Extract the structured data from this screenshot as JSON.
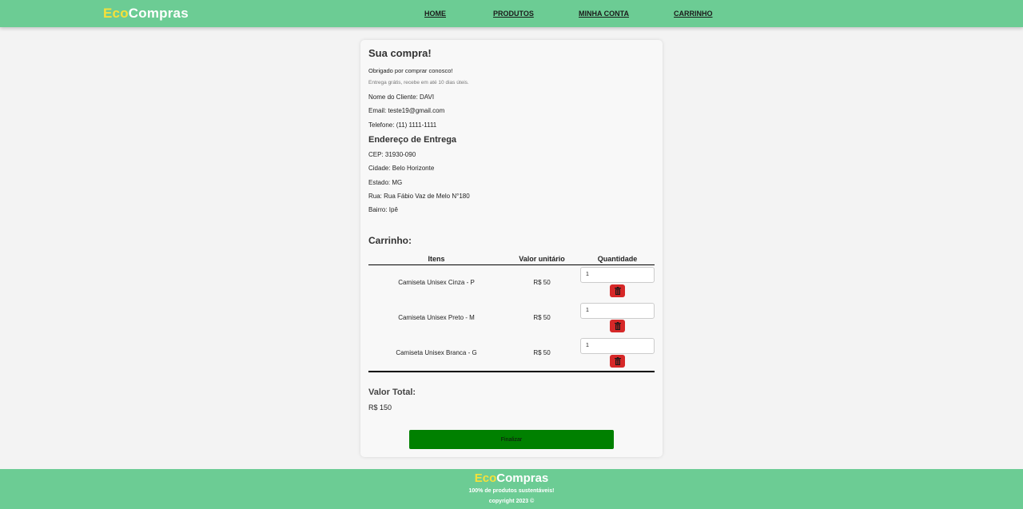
{
  "header": {
    "logo_eco": "Eco",
    "logo_compras": "Compras",
    "nav": [
      {
        "label": "HOME"
      },
      {
        "label": "PRODUTOS"
      },
      {
        "label": "MINHA CONTA"
      },
      {
        "label": "CARRINHO"
      }
    ]
  },
  "order": {
    "title": "Sua compra!",
    "thanks": "Obrigado por comprar conosco!",
    "delivery_note": "Entrega grátis, recebe em até 10 dias úteis.",
    "customer_name": "Nome do Cliente: DAVI",
    "email": "Email: teste19@gmail.com",
    "phone": "Telefone: (11) 1111-1111",
    "address_title": "Endereço de Entrega",
    "cep": "CEP: 31930-090",
    "city": "Cidade: Belo Horizonte",
    "state": "Estado: MG",
    "street": "Rua: Rua Fábio Vaz de Melo N°180",
    "district": "Bairro: Ipê"
  },
  "cart": {
    "title": "Carrinho:",
    "columns": [
      "Itens",
      "Valor unitário",
      "Quantidade"
    ],
    "items": [
      {
        "name": "Camiseta Unisex Cinza - P",
        "price": "R$ 50",
        "qty": "1"
      },
      {
        "name": "Camiseta Unisex Preto - M",
        "price": "R$ 50",
        "qty": "1"
      },
      {
        "name": "Camiseta Unisex Branca - G",
        "price": "R$ 50",
        "qty": "1"
      }
    ],
    "total_label": "Valor Total:",
    "total_value": "R$ 150",
    "finish_label": "Finalizar"
  },
  "footer": {
    "logo_eco": "Eco",
    "logo_compras": "Compras",
    "tagline": "100% de produtos sustentáveis!",
    "copyright": "copyright 2023 ©"
  },
  "colors": {
    "brand_green": "#6ccc94",
    "logo_yellow": "#f5e13a",
    "delete_red": "#d62828",
    "finish_green": "#008000"
  }
}
